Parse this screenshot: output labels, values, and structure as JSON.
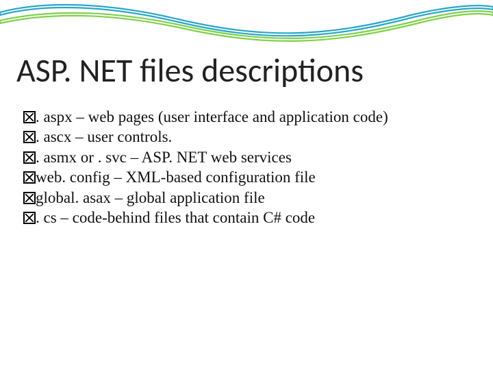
{
  "slide": {
    "title": "ASP. NET files descriptions",
    "bullets": [
      ". aspx – web pages (user interface and application code)",
      ". ascx – user controls.",
      ". asmx or . svc – ASP. NET web services",
      "web. config – XML-based configuration file",
      "global. asax – global application file",
      ". cs – code-behind files that contain C# code"
    ]
  }
}
